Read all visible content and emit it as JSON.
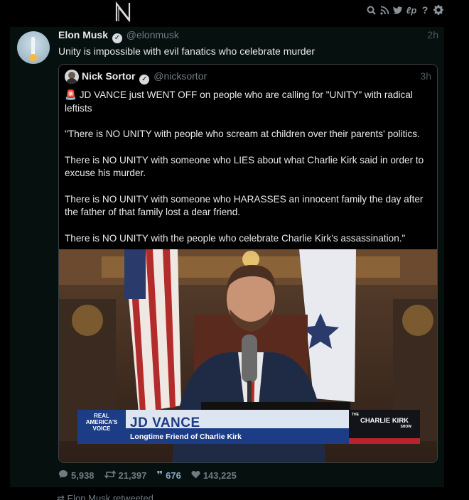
{
  "app": {
    "logo_letter": "N",
    "toolbar_icons": [
      "search-icon",
      "rss-icon",
      "twitter-icon",
      "link-icon",
      "help-icon",
      "settings-icon"
    ]
  },
  "tweet": {
    "author_name": "Elon Musk",
    "author_handle": "@elonmusk",
    "time": "2h",
    "text": "Unity is impossible with evil fanatics who celebrate murder",
    "quoted": {
      "author_name": "Nick Sortor",
      "author_handle": "@nicksortor",
      "time": "3h",
      "paragraphs": [
        "🚨 JD VANCE just WENT OFF on people who are calling for \"UNITY\" with radical leftists",
        "\"There is NO UNITY with people who scream at children over their parents' politics.",
        "There is NO UNITY with someone who LIES about what Charlie Kirk said in order to excuse his murder.",
        "There is NO UNITY with someone who HARASSES an innocent family the day after the father of that family lost a dear friend.",
        "There is NO UNITY with the people who celebrate Charlie Kirk's assassination.\""
      ],
      "media": {
        "network_logo": "REAL AMERICA'S VOICE",
        "lower_third_name": "JD VANCE",
        "lower_third_sub": "Longtime Friend of Charlie Kirk",
        "show_logo_top": "THE",
        "show_logo_main": "CHARLIE KIRK",
        "show_logo_bottom": "SHOW"
      }
    },
    "stats": {
      "replies": "5,938",
      "retweets": "21,397",
      "quotes": "676",
      "likes": "143,225"
    }
  },
  "next_item": {
    "retweeted_label": "Elon Musk retweeted"
  },
  "colors": {
    "background": "#000000",
    "card": "#06100f",
    "muted": "#6f7a82",
    "quote_accent": "#8ba6bf"
  }
}
